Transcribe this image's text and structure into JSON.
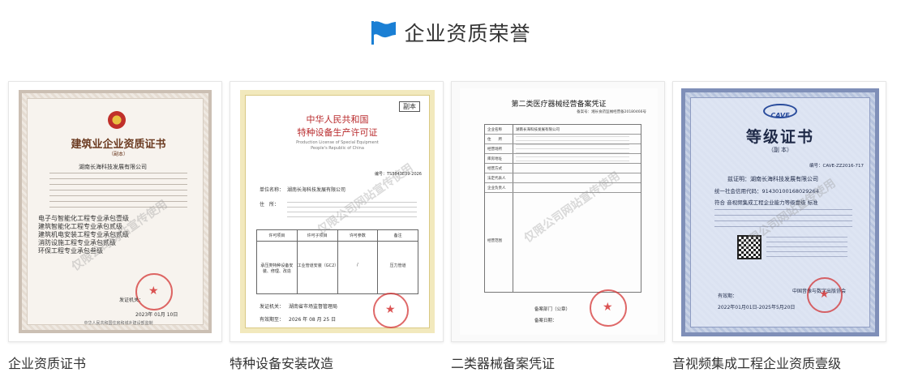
{
  "header": {
    "title": "企业资质荣誉",
    "icon": "flag-icon",
    "accent_color": "#1a7fd4"
  },
  "watermark": "仅限公司网站宣传使用",
  "certificates": [
    {
      "caption": "企业资质证书",
      "heading": "建筑业企业资质证书",
      "subheading": "（副本）",
      "company": "湖南长海科技发展有限公司",
      "date_text": "2023年 01月 10日",
      "lines": [
        "电子与智能化工程专业承包壹级",
        "建筑智能化工程专业承包贰级",
        "建筑机电安装工程专业承包贰级",
        "消防设施工程专业承包贰级",
        "环保工程专业承包叁级"
      ],
      "footer": "中华人民共和国住房和城乡建设部监制",
      "issuer_label": "发证机关："
    },
    {
      "caption": "特种设备安装改造",
      "stamp": "副本",
      "heading": "中华人民共和国",
      "subheading": "特种设备生产许可证",
      "en_title": "Production License of Special Equipment",
      "en_sub": "People's Republic of China",
      "unit_label": "单位名称：",
      "company": "湖南长海科技发展有限公司",
      "addr_label": "住　所：",
      "table_headers": [
        "许可项目",
        "许可子项目",
        "许可参数",
        "备注"
      ],
      "table_row": [
        "承压类特种设备安装、修理、改造",
        "工业管道安装（GC2）",
        "/",
        "压力管道"
      ],
      "issuer_label": "发证机关：",
      "issuer": "湖南省市场监督管理局",
      "date_label": "有效期至：",
      "date_text": "2026 年 08 月 25 日",
      "license_no": "编号：TS3843E39-2026"
    },
    {
      "caption": "二类器械备案凭证",
      "heading": "第二类医疗器械经营备案凭证",
      "record_no": "备案号：湘长食药监械经营备20180466号",
      "rows": [
        "企业名称",
        "住　　所",
        "经营场所",
        "库房地址",
        "经营方式",
        "法定代表人",
        "企业负责人",
        "经营范围"
      ],
      "company": "湖南长海科技发展有限公司",
      "dept_label": "备案部门（公章）",
      "date_label": "备案日期："
    },
    {
      "caption": "音视频集成工程企业资质壹级",
      "logo": "CAVE",
      "heading": "等级证书",
      "subheading": "（副 本）",
      "cert_no": "编号：CAVE-ZZ2016-717",
      "company_line": "兹证明：湖南长海科技发展有限公司",
      "credit_line": "统一社会信用代码：91430100168029264",
      "grade_line": "符合 音视频集成工程企业能力等级壹级 标准",
      "valid_label": "有效期：",
      "valid_range": "2022年01月01日-2025年5月20日",
      "issuer": "中国音像与数字出版协会"
    }
  ]
}
